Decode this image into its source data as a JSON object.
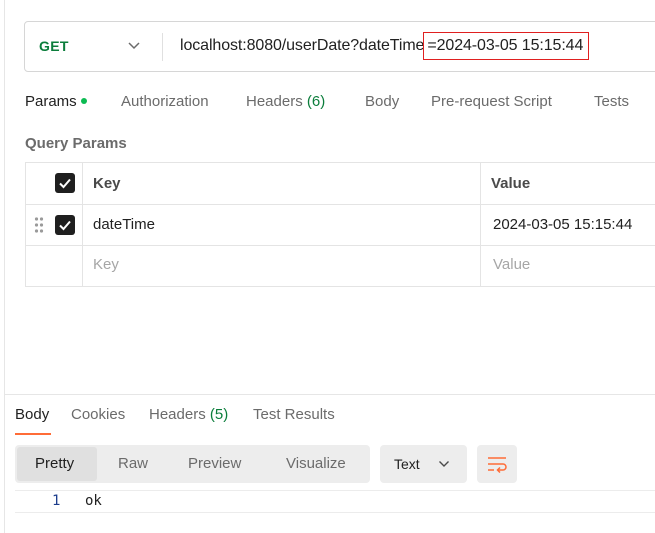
{
  "request": {
    "method": "GET",
    "url_prefix": "localhost:8080/userDate?dateTime",
    "url_highlight": "=2024-03-05 15:15:44"
  },
  "request_tabs": [
    {
      "label": "Params",
      "count": "",
      "active": true,
      "indicator": "dot"
    },
    {
      "label": "Authorization",
      "count": "",
      "active": false
    },
    {
      "label": "Headers",
      "count": "(6)",
      "active": false
    },
    {
      "label": "Body",
      "count": "",
      "active": false
    },
    {
      "label": "Pre-request Script",
      "count": "",
      "active": false
    },
    {
      "label": "Tests",
      "count": "",
      "active": false
    }
  ],
  "query_params": {
    "title": "Query Params",
    "columns": {
      "key": "Key",
      "value": "Value"
    },
    "rows": [
      {
        "checked": true,
        "key": "dateTime",
        "value": "2024-03-05 15:15:44"
      }
    ],
    "placeholder": {
      "key": "Key",
      "value": "Value"
    }
  },
  "response_tabs": [
    {
      "label": "Body",
      "count": "",
      "active": true
    },
    {
      "label": "Cookies",
      "count": "",
      "active": false
    },
    {
      "label": "Headers",
      "count": "(5)",
      "active": false
    },
    {
      "label": "Test Results",
      "count": "",
      "active": false
    }
  ],
  "view_modes": [
    "Pretty",
    "Raw",
    "Preview",
    "Visualize"
  ],
  "view_mode_selected": "Pretty",
  "format": "Text",
  "response_body": {
    "line_number": "1",
    "content": "ok"
  },
  "colors": {
    "method": "#0b7d3b",
    "active_tab_indicator": "#ff6c37",
    "params_dot": "#0cbb52",
    "highlight_border": "#e02020",
    "wrap_icon": "#ff6c37"
  },
  "icons": [
    "chevron-down-icon",
    "drag-handle-icon",
    "checkbox-checked-icon",
    "word-wrap-icon"
  ]
}
